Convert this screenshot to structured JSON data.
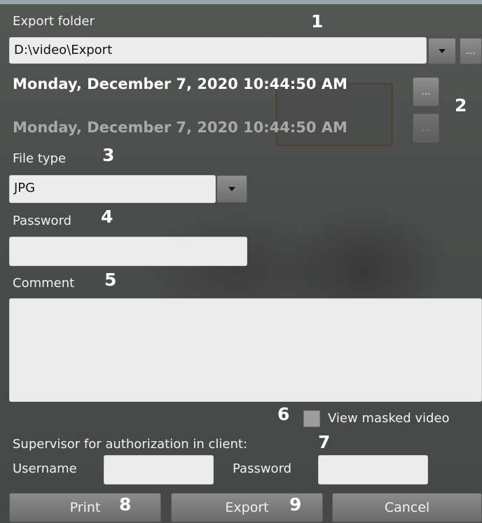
{
  "export_folder": {
    "label": "Export folder",
    "value": "D:\\video\\Export",
    "browse": "..."
  },
  "range": {
    "start": "Monday, December 7, 2020 10:44:50 AM",
    "end": "Monday, December 7, 2020 10:44:50 AM",
    "start_btn": "...",
    "end_btn": "..."
  },
  "file_type": {
    "label": "File type",
    "value": "JPG"
  },
  "password": {
    "label": "Password",
    "value": ""
  },
  "comment": {
    "label": "Comment",
    "value": ""
  },
  "masked": {
    "label": "View masked video",
    "checked": false
  },
  "supervisor": {
    "label": "Supervisor for authorization in client:",
    "username_label": "Username",
    "password_label": "Password"
  },
  "buttons": {
    "print": "Print",
    "export": "Export",
    "cancel": "Cancel"
  },
  "callouts": [
    "1",
    "2",
    "3",
    "4",
    "5",
    "6",
    "7",
    "8",
    "9"
  ]
}
